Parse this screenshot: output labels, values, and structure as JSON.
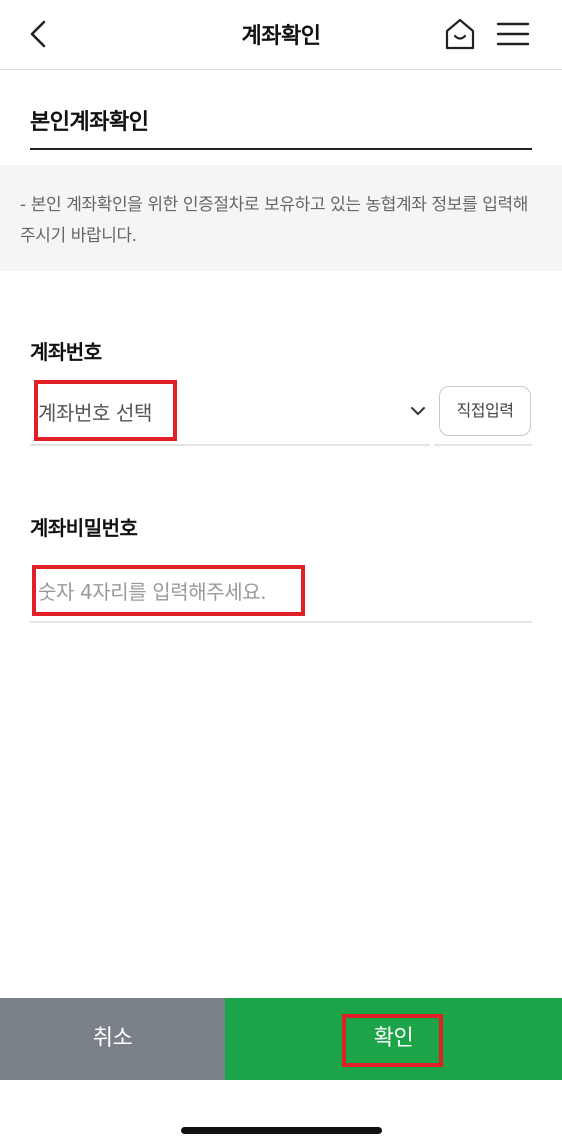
{
  "header": {
    "title": "계좌확인",
    "back_icon": "chevron-left-icon",
    "home_icon": "home-icon",
    "menu_icon": "hamburger-menu-icon"
  },
  "section": {
    "title": "본인계좌확인"
  },
  "notice": {
    "text": "- 본인 계좌확인을 위한 인증절차로 보유하고 있는 농협계좌 정보를 입력해 주시기 바랍니다."
  },
  "account": {
    "label": "계좌번호",
    "select_value": "계좌번호 선택",
    "direct_input_label": "직접입력"
  },
  "password": {
    "label": "계좌비밀번호",
    "placeholder": "숫자 4자리를 입력해주세요."
  },
  "footer": {
    "cancel_label": "취소",
    "confirm_label": "확인"
  },
  "colors": {
    "confirm": "#1ba548",
    "cancel": "#7a8088",
    "highlight": "#e01f26"
  }
}
